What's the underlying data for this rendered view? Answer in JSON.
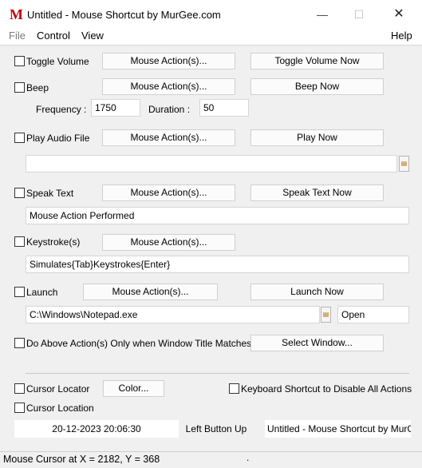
{
  "window": {
    "title": "Untitled - Mouse Shortcut by MurGee.com",
    "app_icon_glyph": "M",
    "min_glyph": "—",
    "max_glyph": "☐",
    "close_glyph": "✕"
  },
  "menu": {
    "file": "File",
    "control": "Control",
    "view": "View",
    "help": "Help"
  },
  "toggle_volume": {
    "label": "Toggle Volume",
    "mouse_action": "Mouse Action(s)...",
    "now": "Toggle Volume Now"
  },
  "beep": {
    "label": "Beep",
    "mouse_action": "Mouse Action(s)...",
    "now": "Beep Now",
    "frequency_label": "Frequency :",
    "frequency": "1750",
    "duration_label": "Duration :",
    "duration": "50"
  },
  "play_audio": {
    "label": "Play Audio File",
    "mouse_action": "Mouse Action(s)...",
    "now": "Play Now",
    "path": ""
  },
  "speak_text": {
    "label": "Speak Text",
    "mouse_action": "Mouse Action(s)...",
    "now": "Speak Text Now",
    "text": "Mouse Action Performed"
  },
  "keystroke": {
    "label": "Keystroke(s)",
    "mouse_action": "Mouse Action(s)...",
    "text": "Simulates{Tab}Keystrokes{Enter}"
  },
  "launch": {
    "label": "Launch",
    "mouse_action": "Mouse Action(s)...",
    "now": "Launch Now",
    "path": "C:\\Windows\\Notepad.exe",
    "verb": "Open"
  },
  "window_match": {
    "label": "Do Above Action(s) Only when Window Title Matches",
    "select": "Select Window..."
  },
  "cursor_locator": {
    "label": "Cursor Locator",
    "color": "Color..."
  },
  "keyboard_shortcut": {
    "label": "Keyboard Shortcut to Disable All Actions"
  },
  "cursor_location": {
    "label": "Cursor Location"
  },
  "info": {
    "datetime": "20-12-2023 20:06:30",
    "event": "Left Button Up",
    "window_title": "Untitled - Mouse Shortcut by MurGe"
  },
  "status": {
    "text": "Mouse Cursor at X = 2182, Y = 368",
    "dot": "."
  }
}
